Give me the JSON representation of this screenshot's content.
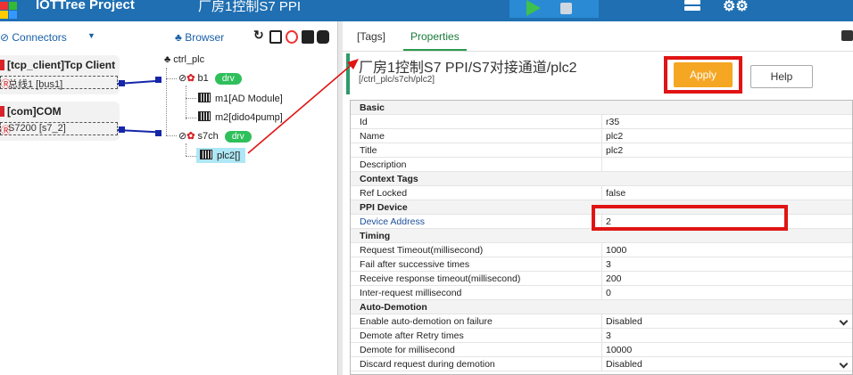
{
  "topbar": {
    "app_title": "IOTTree Project",
    "page_title": "厂房1控制S7 PPI",
    "colors": {
      "bar": "#1f6fb2",
      "play": "#3fc14e"
    }
  },
  "left": {
    "connectors_label": "⊘ Connectors",
    "browser_label": "Browser",
    "connections": [
      {
        "title": "[tcp_client]Tcp Client",
        "sub": "总线1 [bus1]"
      },
      {
        "title": "[com]COM",
        "sub": "S7200 [s7_2]"
      }
    ],
    "tree": {
      "root": "ctrl_plc",
      "b1": "b1",
      "b1_badge": "drv",
      "m1": "m1[AD Module]",
      "m2": "m2[dido4pump]",
      "s7ch": "s7ch",
      "s7ch_badge": "drv",
      "plc2": "plc2[]"
    }
  },
  "right": {
    "tabs": {
      "tags": "[Tags]",
      "properties": "Properties"
    },
    "node_title": "厂房1控制S7 PPI/S7对接通道/plc2",
    "node_path": "[/ctrl_plc/s7ch/plc2]",
    "apply": "Apply",
    "help": "Help",
    "groups": {
      "basic": "Basic",
      "context": "Context Tags",
      "ppi": "PPI Device",
      "timing": "Timing",
      "auto": "Auto-Demotion"
    },
    "rows": {
      "id_k": "Id",
      "id_v": "r35",
      "name_k": "Name",
      "name_v": "plc2",
      "title_k": "Title",
      "title_v": "plc2",
      "desc_k": "Description",
      "desc_v": "",
      "ref_k": "Ref Locked",
      "ref_v": "false",
      "addr_k": "Device Address",
      "addr_v": "2",
      "req_k": "Request Timeout(millisecond)",
      "req_v": "1000",
      "fail_k": "Fail after successive times",
      "fail_v": "3",
      "recv_k": "Receive response timeout(millisecond)",
      "recv_v": "200",
      "inter_k": "Inter-request millisecond",
      "inter_v": "0",
      "enable_k": "Enable auto-demotion on failure",
      "enable_v": "Disabled",
      "demote_k": "Demote after Retry times",
      "demote_v": "3",
      "demms_k": "Demote for millisecond",
      "demms_v": "10000",
      "discard_k": "Discard request during demotion",
      "discard_v": "Disabled"
    },
    "colors": {
      "apply_bg": "#f5a623",
      "highlight": "#e01414",
      "active_tab": "#1a7a3a"
    }
  }
}
